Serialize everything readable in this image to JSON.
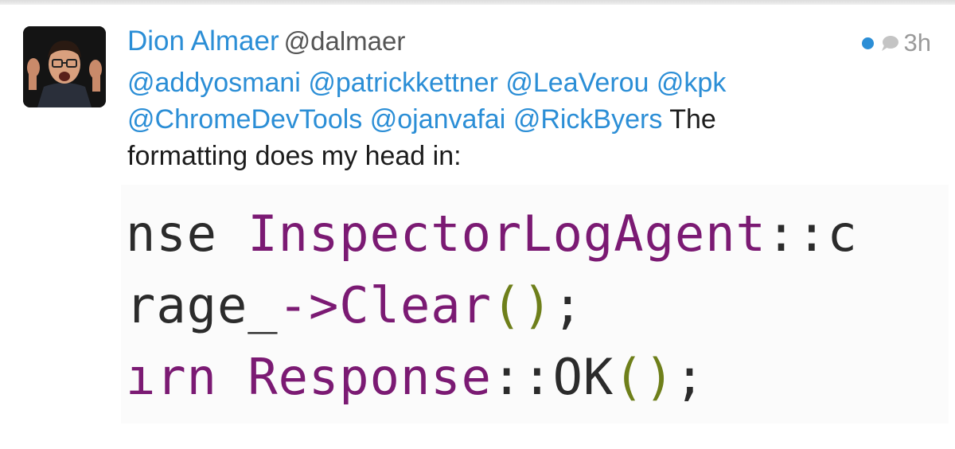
{
  "tweet": {
    "author_name": "Dion Almaer",
    "author_handle": "@dalmaer",
    "timestamp": "3h",
    "mentions_line1": [
      "@addyosmani",
      "@patrickkettner",
      "@LeaVerou",
      "@kpk"
    ],
    "mentions_line2": [
      "@ChromeDevTools",
      "@ojanvafai",
      "@RickByers"
    ],
    "text_after_mentions": "The",
    "text_line3": "formatting does my head in:",
    "icons": {
      "unread": "unread-dot-icon",
      "conversation": "speech-bubble-icon"
    }
  },
  "code_image": {
    "line1": {
      "a": "nse ",
      "b": "InspectorLogAgent",
      "c": "::c"
    },
    "line2": {
      "a": "rage_",
      "b": "->",
      "c": "Clear",
      "d": "()",
      "e": ";"
    },
    "line3": {
      "a": "ırn ",
      "b": "Response",
      "c": "::",
      "d": "OK",
      "e": "()",
      "f": ";"
    }
  },
  "colors": {
    "link_blue": "#2b8ed6",
    "code_purple": "#7b1a73",
    "code_olive": "#6e7f1a"
  }
}
